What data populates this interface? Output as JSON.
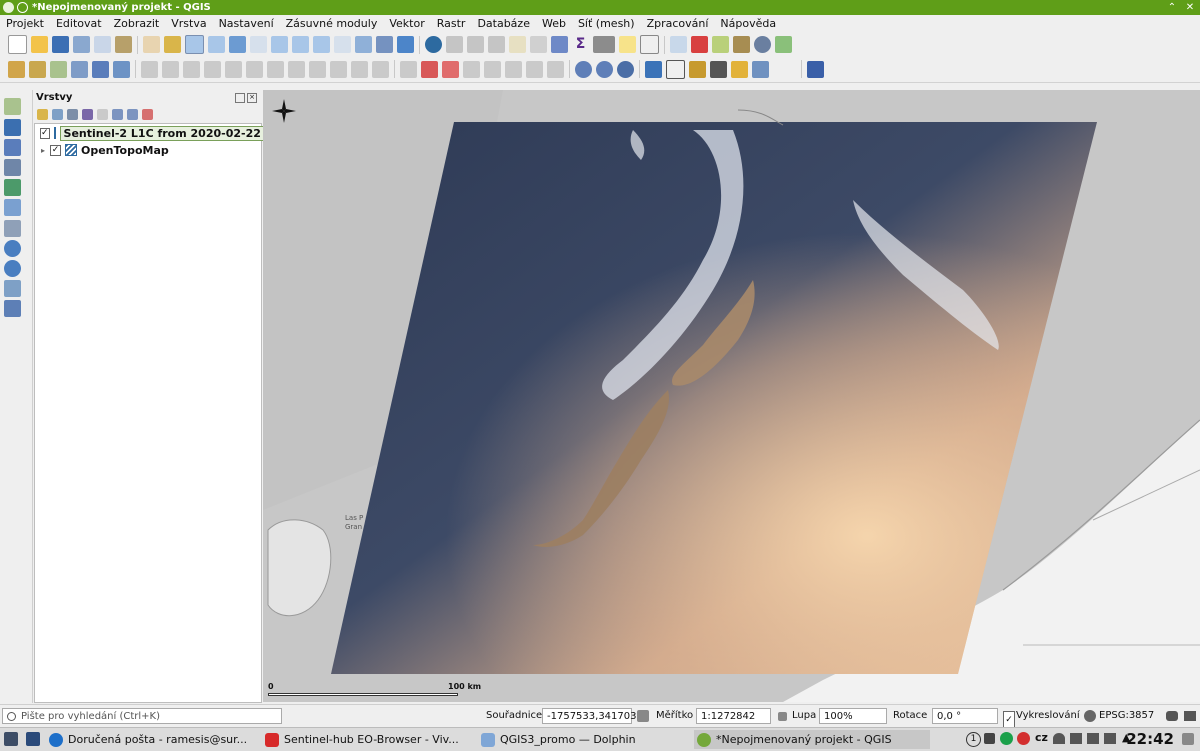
{
  "window": {
    "title": "*Nepojmenovaný projekt - QGIS",
    "buttons": [
      "⌃",
      "✕"
    ]
  },
  "menu": [
    "Projekt",
    "Editovat",
    "Zobrazit",
    "Vrstva",
    "Nastavení",
    "Zásuvné moduly",
    "Vektor",
    "Rastr",
    "Databáze",
    "Web",
    "Síť (mesh)",
    "Zpracování",
    "Nápověda"
  ],
  "layers_panel": {
    "title": "Vrstvy",
    "layers": [
      {
        "name": "Sentinel-2 L1C from 2020-02-22",
        "checked": "✓",
        "expand": ""
      },
      {
        "name": "OpenTopoMap",
        "checked": "✓",
        "expand": "▸"
      }
    ]
  },
  "map": {
    "scale_bar": {
      "start": "0",
      "end": "100 km"
    },
    "label_island": "Las P",
    "label_island2": "Gran",
    "north_arrow": "north-arrow-icon"
  },
  "status": {
    "locator_placeholder": "Pište pro vyhledání (Ctrl+K)",
    "coord_label": "Souřadnice",
    "coord_value": "-1757533,3417031",
    "scale_label": "Měřítko",
    "scale_value": "1:1272842",
    "magnifier_label": "Lupa",
    "magnifier_value": "100%",
    "rotation_label": "Rotace",
    "rotation_value": "0,0 °",
    "render_check": "✓",
    "render_label": "Vykreslování",
    "crs": "EPSG:3857"
  },
  "taskbar": {
    "tasks": [
      {
        "label": "Doručená pošta - ramesis@sur..."
      },
      {
        "label": "Sentinel-hub EO-Browser - Viv..."
      },
      {
        "label": "QGIS3_promo — Dolphin"
      },
      {
        "label": "*Nepojmenovaný projekt - QGIS"
      }
    ],
    "notif_count": "1",
    "lang": "cz",
    "clock": "22:42"
  },
  "colors": {
    "titlebar": "#5f9e18",
    "satellite_dark": "#2f3a52",
    "satellite_glow": "#f2c59a",
    "land_gray": "#d7d7d7"
  }
}
